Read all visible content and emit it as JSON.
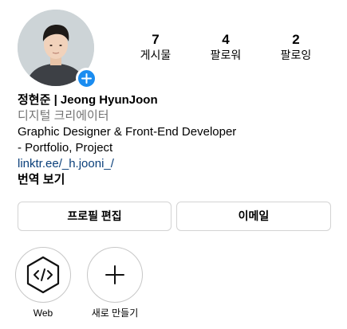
{
  "profile": {
    "stats": {
      "posts": {
        "count": "7",
        "label": "게시물"
      },
      "followers": {
        "count": "4",
        "label": "팔로워"
      },
      "following": {
        "count": "2",
        "label": "팔로잉"
      }
    },
    "name": "정현준 | Jeong HyunJoon",
    "category": "디지털 크리에이터",
    "bio_line1": "Graphic Designer & Front-End Developer",
    "bio_line2": "- Portfolio, Project",
    "link": "linktr.ee/_h.jooni_/",
    "translate_label": "번역 보기"
  },
  "actions": {
    "edit_profile": "프로필 편집",
    "email": "이메일"
  },
  "highlights": [
    {
      "label": "Web",
      "icon": "code-icon"
    },
    {
      "label": "새로 만들기",
      "icon": "plus-icon"
    }
  ],
  "colors": {
    "accent_blue": "#1a8cf0",
    "link": "#0a3f7a",
    "muted": "#737373",
    "border": "#d3d3d3"
  }
}
